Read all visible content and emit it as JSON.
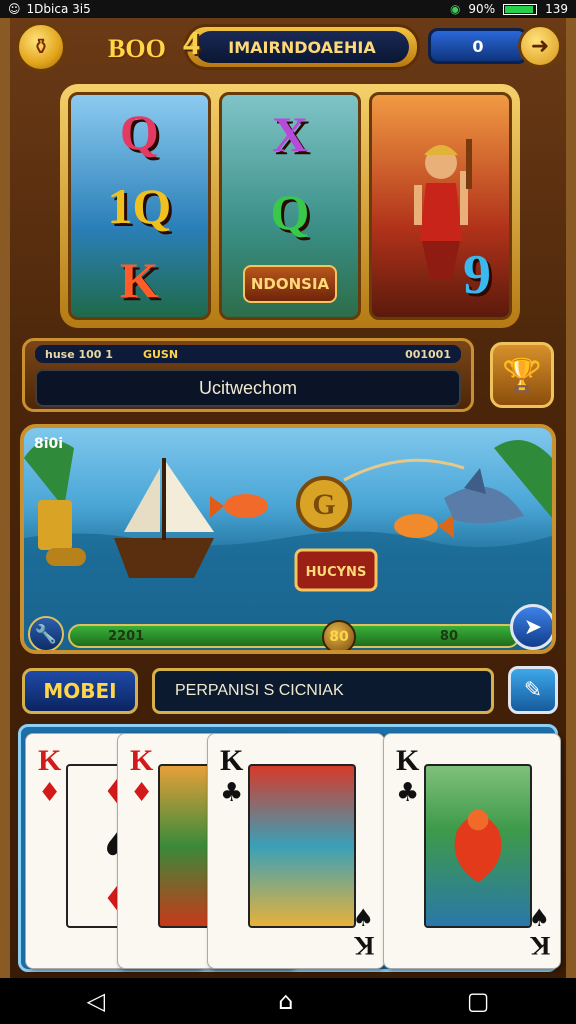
{
  "status_bar": {
    "left_time": "1Dbica 3i5",
    "battery_pct": "90%",
    "right_time": "139"
  },
  "header": {
    "brand": "BOO",
    "title": "IMAIRNDOAEHIA",
    "emblem": "4",
    "balance": "0"
  },
  "reels": {
    "col1": [
      "Q",
      "1Q",
      "K"
    ],
    "col2_top": [
      "X",
      "Q"
    ],
    "col2_badge": "NDONSIA",
    "col3_symbol": "9"
  },
  "info_panel": {
    "strip_left": "huse 100 1",
    "strip_mid": "GUSN",
    "strip_right": "001001",
    "message": "Ucitwechom"
  },
  "fishing": {
    "label": "8i0i",
    "progress_left": "2201",
    "progress_right": "80",
    "knob_label": "80",
    "center_badge": "HUCYNS"
  },
  "controls": {
    "mode_button": "MOBEI",
    "message_field": "PERPANISI S CICNIAK"
  },
  "cards": [
    {
      "rank": "K",
      "suit": "♦",
      "color": "#d21a1a",
      "bottom_suit": "♠"
    },
    {
      "rank": "K",
      "suit": "♦",
      "color": "#d21a1a",
      "bottom_suit": "♠"
    },
    {
      "rank": "K",
      "suit": "♣",
      "color": "#111111",
      "bottom_suit": "♠"
    },
    {
      "rank": "K",
      "suit": "♣",
      "color": "#111111",
      "bottom_suit": "♠"
    }
  ],
  "icons": {
    "back": "back-icon",
    "home": "home-icon",
    "recents": "recents-icon"
  },
  "colors": {
    "gold": "#f3c443",
    "panel_blue": "#0b1a2e",
    "frame_brown": "#4a2509"
  }
}
